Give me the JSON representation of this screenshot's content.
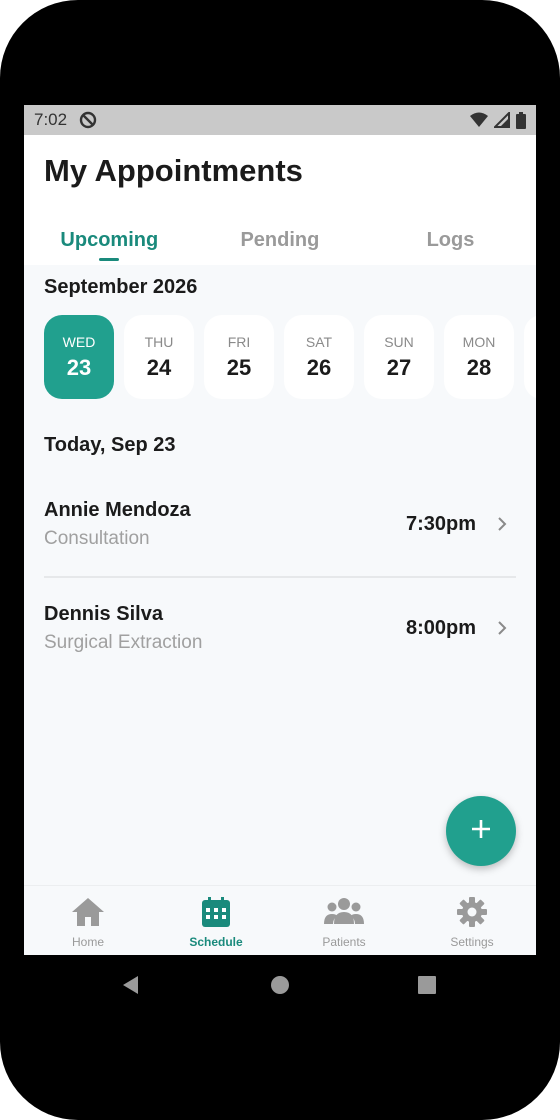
{
  "status_bar": {
    "time": "7:02"
  },
  "header": {
    "title": "My Appointments",
    "tabs": [
      {
        "label": "Upcoming",
        "active": true
      },
      {
        "label": "Pending",
        "active": false
      },
      {
        "label": "Logs",
        "active": false
      }
    ]
  },
  "calendar": {
    "month_label": "September 2026",
    "days": [
      {
        "dow": "WED",
        "num": "23",
        "selected": true
      },
      {
        "dow": "THU",
        "num": "24",
        "selected": false
      },
      {
        "dow": "FRI",
        "num": "25",
        "selected": false
      },
      {
        "dow": "SAT",
        "num": "26",
        "selected": false
      },
      {
        "dow": "SUN",
        "num": "27",
        "selected": false
      },
      {
        "dow": "MON",
        "num": "28",
        "selected": false
      }
    ]
  },
  "today_heading": "Today, Sep 23",
  "appointments": [
    {
      "name": "Annie Mendoza",
      "type": "Consultation",
      "time": "7:30pm"
    },
    {
      "name": "Dennis Silva",
      "type": "Surgical Extraction",
      "time": "8:00pm"
    }
  ],
  "fab": {
    "icon": "plus-icon"
  },
  "bottom_nav": [
    {
      "label": "Home",
      "icon": "home-icon",
      "active": false
    },
    {
      "label": "Schedule",
      "icon": "calendar-icon",
      "active": true
    },
    {
      "label": "Patients",
      "icon": "people-icon",
      "active": false
    },
    {
      "label": "Settings",
      "icon": "gear-icon",
      "active": false
    }
  ],
  "colors": {
    "accent": "#21a08e",
    "accent_text": "#1a8a7c",
    "muted": "#9a9a9a"
  }
}
